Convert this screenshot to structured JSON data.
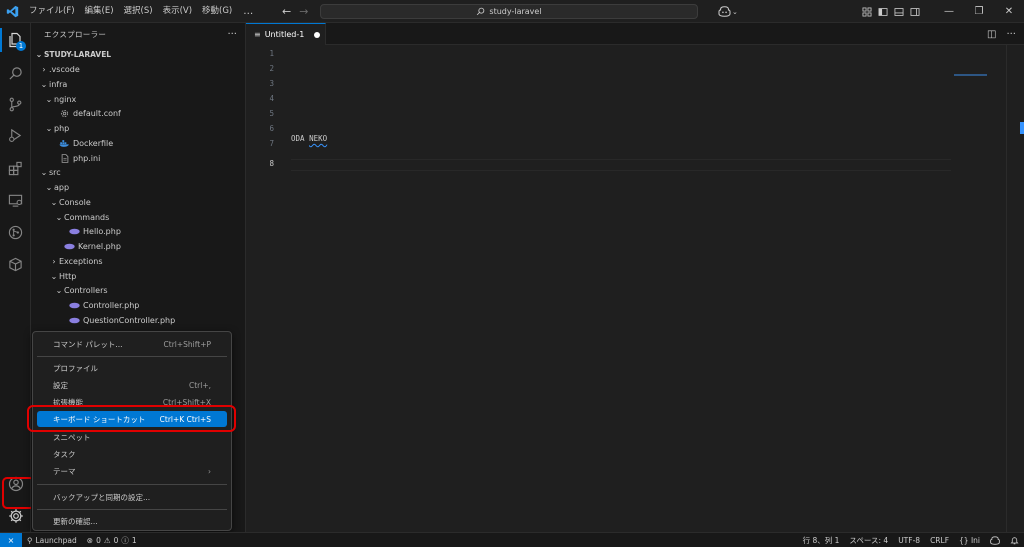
{
  "titlebar": {
    "menus": [
      "ファイル(F)",
      "編集(E)",
      "選択(S)",
      "表示(V)",
      "移動(G)"
    ],
    "more": "…",
    "search": "study-laravel"
  },
  "activitybar": {
    "explorer_badge": "1",
    "items": [
      "files-icon",
      "search-icon",
      "source-control-icon",
      "run-debug-icon",
      "extensions-icon",
      "remote-explorer-icon",
      "git-icon",
      "docker-icon"
    ]
  },
  "sidebar": {
    "title": "エクスプローラー",
    "more": "···",
    "root": "STUDY-LARAVEL",
    "tree": [
      {
        "label": ".vscode",
        "chevron": "›",
        "indent": 1,
        "icon": ""
      },
      {
        "label": "infra",
        "chevron": "⌄",
        "indent": 1,
        "icon": ""
      },
      {
        "label": "nginx",
        "chevron": "⌄",
        "indent": 2,
        "icon": ""
      },
      {
        "label": "default.conf",
        "chevron": "",
        "indent": 3,
        "icon": "gear"
      },
      {
        "label": "php",
        "chevron": "⌄",
        "indent": 2,
        "icon": ""
      },
      {
        "label": "Dockerfile",
        "chevron": "",
        "indent": 3,
        "icon": "docker"
      },
      {
        "label": "php.ini",
        "chevron": "",
        "indent": 3,
        "icon": "doc"
      },
      {
        "label": "src",
        "chevron": "⌄",
        "indent": 1,
        "icon": ""
      },
      {
        "label": "app",
        "chevron": "⌄",
        "indent": 2,
        "icon": ""
      },
      {
        "label": "Console",
        "chevron": "⌄",
        "indent": 3,
        "icon": ""
      },
      {
        "label": "Commands",
        "chevron": "⌄",
        "indent": 4,
        "icon": ""
      },
      {
        "label": "Hello.php",
        "chevron": "",
        "indent": 5,
        "icon": "php"
      },
      {
        "label": "Kernel.php",
        "chevron": "",
        "indent": 4,
        "icon": "php"
      },
      {
        "label": "Exceptions",
        "chevron": "›",
        "indent": 3,
        "icon": ""
      },
      {
        "label": "Http",
        "chevron": "⌄",
        "indent": 3,
        "icon": ""
      },
      {
        "label": "Controllers",
        "chevron": "⌄",
        "indent": 4,
        "icon": ""
      },
      {
        "label": "Controller.php",
        "chevron": "",
        "indent": 5,
        "icon": "php"
      },
      {
        "label": "QuestionController.php",
        "chevron": "",
        "indent": 5,
        "icon": "php"
      }
    ]
  },
  "editor": {
    "tab_label": "Untitled-1",
    "line_numbers": [
      "1",
      "2",
      "3",
      "4",
      "5",
      "6",
      "7",
      "8"
    ],
    "current_line": "8",
    "line6_word1": "ODA",
    "line6_word2": "NEKO"
  },
  "context_menu": {
    "items": [
      {
        "label": "コマンド パレット...",
        "kb": "Ctrl+Shift+P"
      },
      {
        "label": "プロファイル",
        "kb": ""
      },
      {
        "label": "設定",
        "kb": "Ctrl+,"
      },
      {
        "label": "拡張機能",
        "kb": "Ctrl+Shift+X"
      },
      {
        "label": "キーボード ショートカット",
        "kb": "Ctrl+K Ctrl+S",
        "selected": true
      },
      {
        "label": "スニペット",
        "kb": ""
      },
      {
        "label": "タスク",
        "kb": ""
      },
      {
        "label": "テーマ",
        "kb": "›"
      },
      {
        "label": "バックアップと同期の設定...",
        "kb": ""
      },
      {
        "label": "更新の確認...",
        "kb": ""
      }
    ]
  },
  "statusbar": {
    "launchpad": "Launchpad",
    "errors": "0",
    "warnings": "0",
    "info": "1",
    "position": "行 8、列 1",
    "spaces": "スペース: 4",
    "encoding": "UTF-8",
    "eol": "CRLF",
    "language": "{} Ini"
  },
  "colors": {
    "accent": "#0078d4",
    "highlight_box": "#e00000"
  }
}
